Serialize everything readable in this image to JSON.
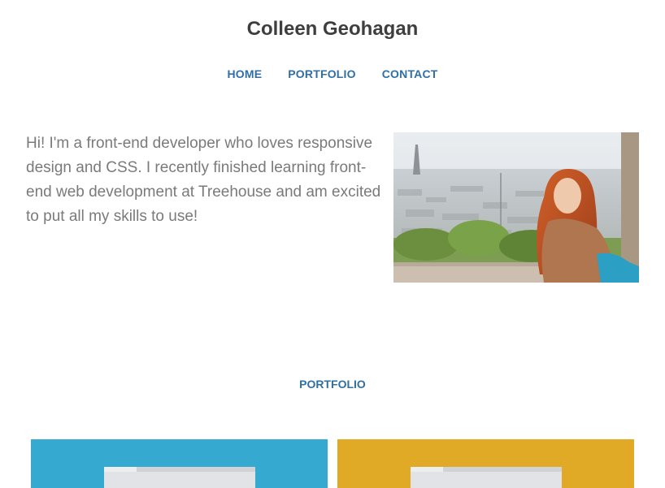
{
  "site": {
    "title": "Colleen Geohagan"
  },
  "nav": {
    "items": [
      {
        "label": "HOME"
      },
      {
        "label": "PORTFOLIO"
      },
      {
        "label": "CONTACT"
      }
    ]
  },
  "intro": {
    "text": "Hi! I'm a front-end developer who loves responsive design and CSS. I recently finished learning front-end web development at Treehouse and am excited to put all my skills to use!"
  },
  "portfolio": {
    "heading": "PORTFOLIO",
    "cards": [
      {
        "color": "#35a9d0"
      },
      {
        "color": "#e0a926"
      }
    ]
  },
  "colors": {
    "link": "#2f6fa6",
    "title": "#3e3e3e",
    "body_text": "#7a7a7a"
  }
}
